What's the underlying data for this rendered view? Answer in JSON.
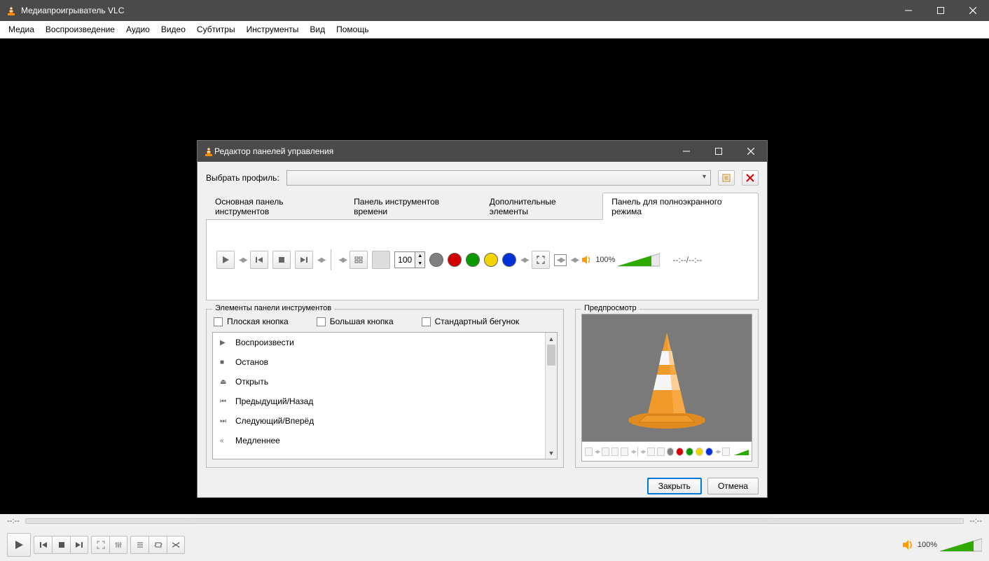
{
  "app": {
    "title": "Медиапроигрыватель VLC"
  },
  "menu": [
    "Медиа",
    "Воспроизведение",
    "Аудио",
    "Видео",
    "Субтитры",
    "Инструменты",
    "Вид",
    "Помощь"
  ],
  "seek": {
    "left": "--:--",
    "right": "--:--"
  },
  "volume": {
    "label": "100%"
  },
  "dialog": {
    "title": "Редактор панелей управления",
    "profile_label": "Выбрать профиль:",
    "tabs": [
      {
        "label": "Основная панель инструментов",
        "active": false
      },
      {
        "label": "Панель инструментов времени",
        "active": false
      },
      {
        "label": "Дополнительные элементы",
        "active": false
      },
      {
        "label": "Панель для полноэкранного режима",
        "active": true
      }
    ],
    "spin_value": "100",
    "colors": [
      "#808080",
      "#d40000",
      "#0a9a00",
      "#f2d400",
      "#0030d8"
    ],
    "vol_label": "100%",
    "time_display": "--:--/--:--",
    "elements_legend": "Элементы панели инструментов",
    "checkboxes": [
      "Плоская кнопка",
      "Большая кнопка",
      "Стандартный бегунок"
    ],
    "list": [
      {
        "icon": "▶",
        "label": "Воспроизвести"
      },
      {
        "icon": "■",
        "label": "Останов"
      },
      {
        "icon": "⏏",
        "label": "Открыть"
      },
      {
        "icon": "⏮",
        "label": "Предыдущий/Назад"
      },
      {
        "icon": "⏭",
        "label": "Следующий/Вперёд"
      },
      {
        "icon": "«",
        "label": "Медленнее"
      }
    ],
    "preview_legend": "Предпросмотр",
    "close": "Закрыть",
    "cancel": "Отмена"
  }
}
